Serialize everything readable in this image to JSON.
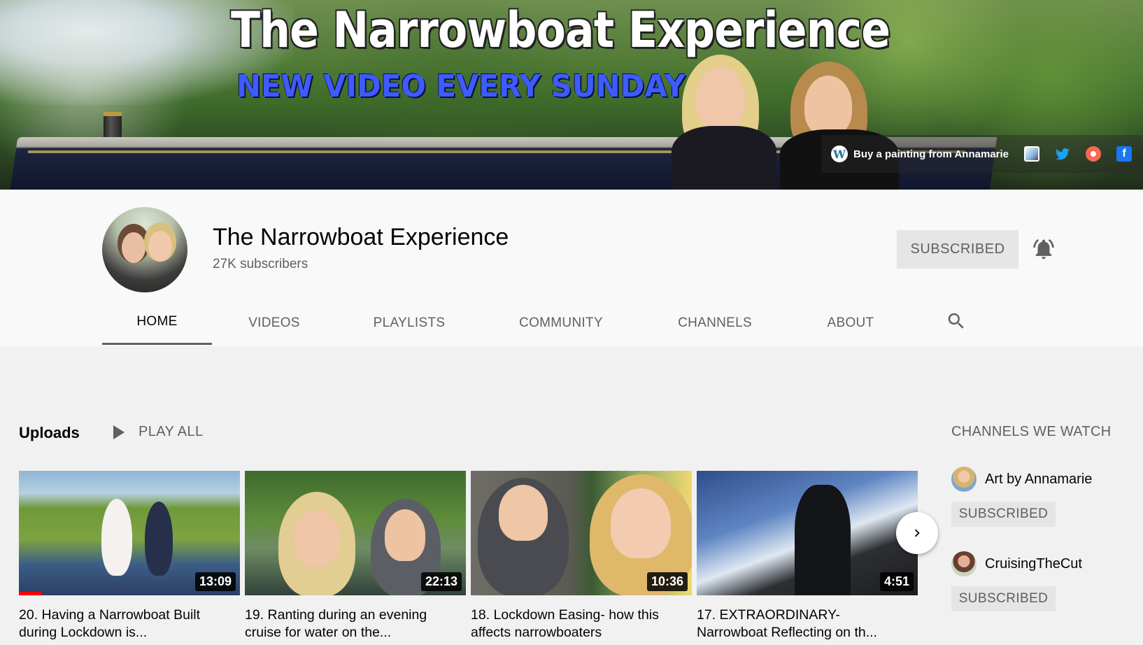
{
  "banner": {
    "title": "The Narrowboat Experience",
    "subtitle": "NEW VIDEO EVERY SUNDAY",
    "link_text": "Buy a painting from Annamarie",
    "link_icons": [
      "wordpress-icon",
      "art-icon",
      "twitter-icon",
      "patreon-icon",
      "facebook-icon"
    ]
  },
  "channel": {
    "name": "The Narrowboat Experience",
    "subscribers": "27K subscribers",
    "subscribe_button": "SUBSCRIBED"
  },
  "tabs": [
    {
      "label": "HOME",
      "active": true
    },
    {
      "label": "VIDEOS",
      "active": false
    },
    {
      "label": "PLAYLISTS",
      "active": false
    },
    {
      "label": "COMMUNITY",
      "active": false
    },
    {
      "label": "CHANNELS",
      "active": false
    },
    {
      "label": "ABOUT",
      "active": false
    }
  ],
  "uploads": {
    "title": "Uploads",
    "play_all": "PLAY ALL",
    "videos": [
      {
        "title": "20. Having a Narrowboat Built during Lockdown is...",
        "duration": "13:09",
        "watched": 0.1
      },
      {
        "title": "19. Ranting during an evening cruise for water on the...",
        "duration": "22:13",
        "watched": 0
      },
      {
        "title": "18. Lockdown Easing- how this affects narrowboaters",
        "duration": "10:36",
        "watched": 0
      },
      {
        "title": "17. EXTRAORDINARY- Narrowboat Reflecting on th...",
        "duration": "4:51",
        "watched": 0
      }
    ]
  },
  "channels_we_watch": {
    "title": "CHANNELS WE WATCH",
    "items": [
      {
        "name": "Art by Annamarie",
        "button": "SUBSCRIBED"
      },
      {
        "name": "CruisingTheCut",
        "button": "SUBSCRIBED"
      }
    ]
  },
  "colors": {
    "background": "#f1f1f1",
    "header_background": "#f9f9f9",
    "progress_red": "#ff0000",
    "muted_text": "#606060"
  }
}
